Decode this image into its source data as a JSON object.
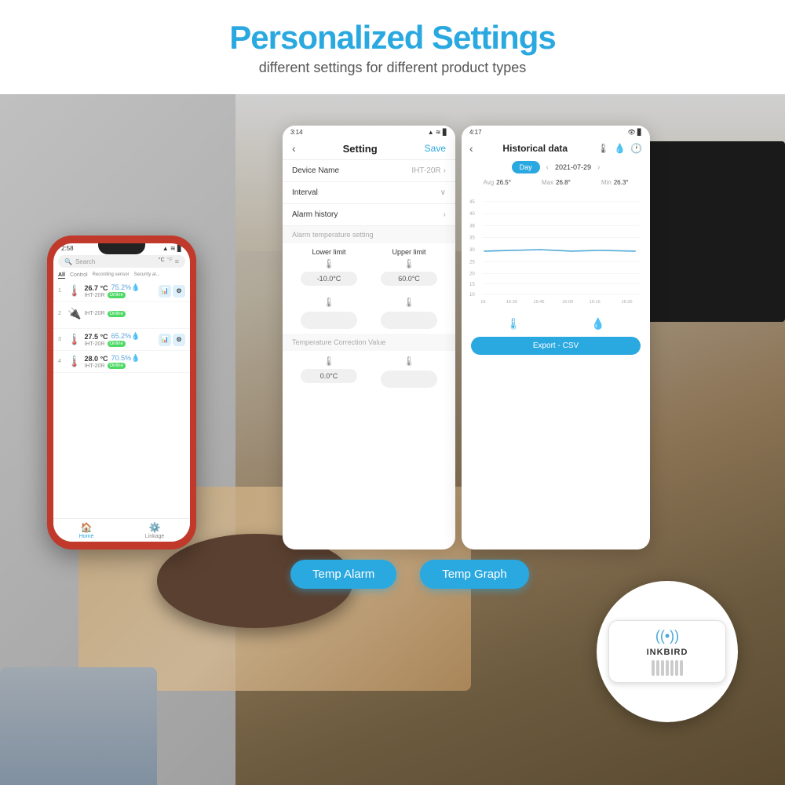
{
  "header": {
    "title": "Personalized Settings",
    "subtitle": "different settings for different product types"
  },
  "phone": {
    "time": "2:58",
    "search_placeholder": "Search",
    "unit1": "°C",
    "unit2": "°F",
    "tabs": [
      "All",
      "Control",
      "Recording sensor",
      "Security al..."
    ],
    "devices": [
      {
        "num": "1",
        "temp": "26.7 °C",
        "hum": "75.2%",
        "name": "IHT-20R",
        "status": "Online"
      },
      {
        "num": "2",
        "name": "IHT-20R",
        "status": "Online"
      },
      {
        "num": "3",
        "temp": "27.5 °C",
        "hum": "65.2%",
        "name": "IHT-20R",
        "status": "Online"
      },
      {
        "num": "4",
        "temp": "28.0 °C",
        "hum": "70.5%",
        "name": "IHT-20R",
        "status": "Online"
      }
    ],
    "nav": [
      {
        "label": "Home",
        "icon": "🏠",
        "active": true
      },
      {
        "label": "Linkage",
        "icon": "⚙️",
        "active": false
      }
    ]
  },
  "setting_screen": {
    "time": "3:14",
    "nav_back": "‹",
    "title": "Setting",
    "nav_action": "Save",
    "rows": [
      {
        "label": "Device Name",
        "value": "IHT-20R"
      },
      {
        "label": "Interval",
        "value": ""
      },
      {
        "label": "Alarm history",
        "value": ""
      }
    ],
    "alarm_section": "Alarm temperature setting",
    "lower_limit_label": "Lower limit",
    "upper_limit_label": "Upper limit",
    "lower_limit_val1": "-10.0°C",
    "upper_limit_val1": "60.0°C",
    "lower_limit_val2": "",
    "upper_limit_val2": "",
    "correction_section": "Temperature Correction Value",
    "correction_val1": "0.0°C",
    "correction_val2": ""
  },
  "hist_screen": {
    "time": "4:17",
    "title": "Historical data",
    "day_label": "Day",
    "date": "2021-07-29",
    "avg_label": "Avg",
    "avg_val": "26.5°",
    "max_label": "Max",
    "max_val": "26.8°",
    "min_label": "Min",
    "min_val": "26.3°",
    "chart_labels": [
      "16",
      "16:30",
      "15:45",
      "16:00",
      "16:15",
      "16:30"
    ],
    "y_labels": [
      "45",
      "40",
      "38",
      "35",
      "30",
      "25",
      "20",
      "15",
      "10"
    ],
    "export_label": "Export - CSV"
  },
  "feature_buttons": {
    "temp_alarm": "Temp Alarm",
    "temp_graph": "Temp Graph"
  },
  "inkbird": {
    "label": "INKBIRD",
    "vents": [
      "",
      "",
      "",
      "",
      "",
      "",
      ""
    ]
  }
}
